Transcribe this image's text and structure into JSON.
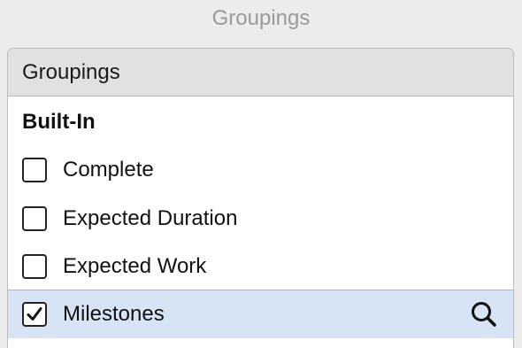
{
  "window": {
    "title": "Groupings"
  },
  "panel": {
    "header": "Groupings",
    "section": "Built-In",
    "items": [
      {
        "label": "Complete",
        "checked": false
      },
      {
        "label": "Expected Duration",
        "checked": false
      },
      {
        "label": "Expected Work",
        "checked": false
      },
      {
        "label": "Milestones",
        "checked": true,
        "selected": true,
        "icon": "search-icon"
      }
    ]
  },
  "colors": {
    "selected_row": "#d6e4f6",
    "header_bg": "#dfe2df"
  }
}
